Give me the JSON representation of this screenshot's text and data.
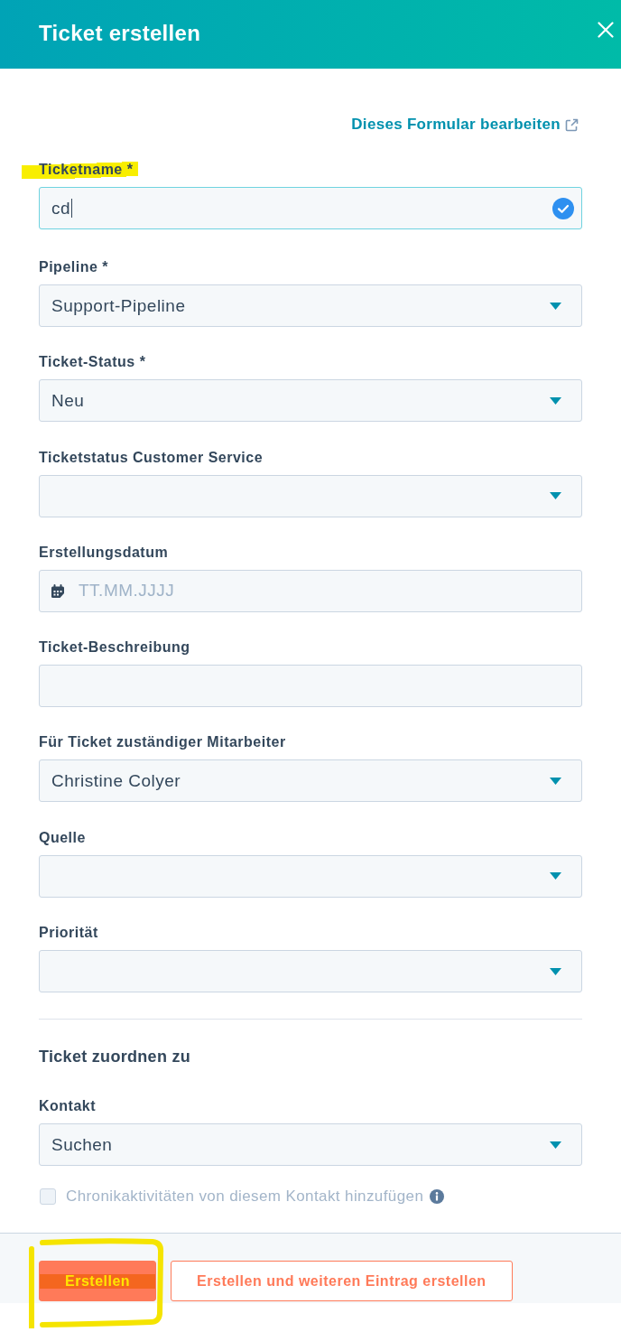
{
  "header": {
    "title": "Ticket erstellen"
  },
  "edit_form_link": {
    "label": "Dieses Formular bearbeiten"
  },
  "fields": [
    {
      "label": "Ticketname *",
      "kind": "text",
      "value": "cd",
      "focused": true,
      "validated": true,
      "highlighted": true
    },
    {
      "label": "Pipeline *",
      "kind": "select",
      "value": "Support-Pipeline",
      "focused": false,
      "validated": false,
      "highlighted": false
    },
    {
      "label": "Ticket-Status *",
      "kind": "select",
      "value": "Neu",
      "focused": false,
      "validated": false,
      "highlighted": false
    },
    {
      "label": "Ticketstatus Customer Service",
      "kind": "select",
      "focused": false,
      "validated": false,
      "highlighted": false
    },
    {
      "label": "Erstellungsdatum",
      "kind": "date",
      "placeholder": "TT.MM.JJJJ",
      "focused": false,
      "validated": false,
      "highlighted": false
    },
    {
      "label": "Ticket-Beschreibung",
      "kind": "text",
      "focused": false,
      "validated": false,
      "highlighted": false
    },
    {
      "label": "Für Ticket zuständiger Mitarbeiter",
      "kind": "select",
      "value": "Christine Colyer",
      "focused": false,
      "validated": false,
      "highlighted": false
    },
    {
      "label": "Quelle",
      "kind": "select",
      "focused": false,
      "validated": false,
      "highlighted": false
    },
    {
      "label": "Priorität",
      "kind": "select",
      "focused": false,
      "validated": false,
      "highlighted": false
    }
  ],
  "association": {
    "title": "Ticket zuordnen zu",
    "fields": [
      {
        "label": "Kontakt",
        "kind": "select",
        "value": "Suchen",
        "focused": false,
        "validated": false,
        "highlighted": false
      }
    ],
    "checkbox": {
      "label": "Chronikaktivitäten von diesem Kontakt hinzufügen",
      "checked": false,
      "disabled": true
    }
  },
  "footer": {
    "buttons": [
      {
        "label": "Erstellen",
        "kind": "primary",
        "highlighted": true
      },
      {
        "label": "Erstellen und weiteren Eintrag erstellen",
        "kind": "secondary",
        "highlighted": false
      }
    ]
  }
}
